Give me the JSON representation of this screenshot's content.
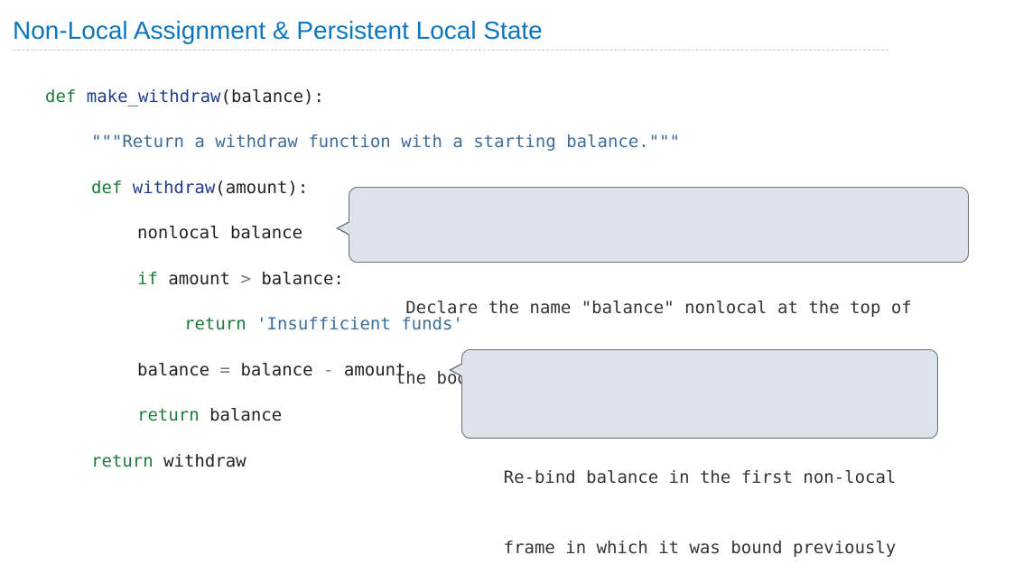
{
  "title": "Non-Local Assignment & Persistent Local State",
  "code": {
    "line1": {
      "kw": "def",
      "name": "make_withdraw",
      "open": "(",
      "param": "balance",
      "close": "):"
    },
    "line2": {
      "docstring": "\"\"\"Return a withdraw function with a starting balance.\"\"\""
    },
    "line3": {
      "kw": "def",
      "name": "withdraw",
      "open": "(",
      "param": "amount",
      "close": "):"
    },
    "line4": {
      "kw": "nonlocal",
      "name": "balance"
    },
    "line5": {
      "kw": "if",
      "left": "amount",
      "op": ">",
      "right": "balance:"
    },
    "line6": {
      "kw": "return",
      "str": "'Insufficient funds'"
    },
    "line7": {
      "target": "balance",
      "eq": "=",
      "left": "balance",
      "op": "-",
      "right": "amount"
    },
    "line8": {
      "kw": "return",
      "value": "balance"
    },
    "line9": {
      "kw": "return",
      "value": "withdraw"
    }
  },
  "callouts": {
    "nonlocal": {
      "line1": "Declare the name \"balance\" nonlocal at the top of",
      "line2": "the body of the function in which it is re-assigned"
    },
    "rebind": {
      "line1": "Re-bind balance in the first non-local",
      "line2": "frame in which it was bound previously"
    }
  }
}
